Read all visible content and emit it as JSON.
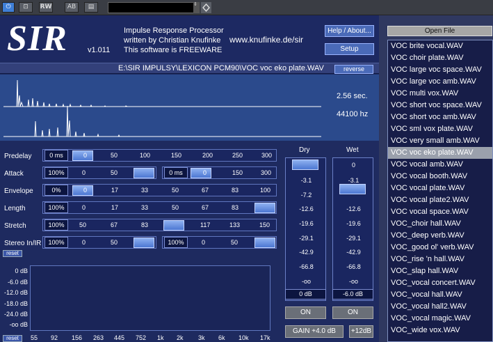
{
  "host": {
    "power": "⏻",
    "compare": "⊡",
    "rw": "RW",
    "ab": "AB",
    "menu": "▤",
    "arrows": "⇕",
    "preset": ""
  },
  "header": {
    "logo": "SIR",
    "version": "v1.011",
    "line1": "Impulse Response Processor",
    "line2": "written by Christian Knufinke",
    "line3": "This software is FREEWARE",
    "url": "www.knufinke.de/sir",
    "help": "Help / About...",
    "setup": "Setup"
  },
  "file": {
    "path": "E:\\SIR IMPULSY\\LEXICON PCM90\\VOC voc eko plate.WAV",
    "reverse": "reverse",
    "duration": "2.56 sec.",
    "samplerate": "44100 hz"
  },
  "params": {
    "predelay": {
      "label": "Predelay",
      "value": "0 ms",
      "ticks": [
        "0",
        "50",
        "100",
        "150",
        "200",
        "250",
        "300"
      ]
    },
    "attack": {
      "label": "Attack",
      "value": "100%",
      "ticks": [
        "0",
        "50"
      ],
      "value2": "0 ms",
      "ticks2": [
        "0",
        "150",
        "300"
      ]
    },
    "envelope": {
      "label": "Envelope",
      "value": "0%",
      "ticks": [
        "0",
        "17",
        "33",
        "50",
        "67",
        "83",
        "100"
      ]
    },
    "length": {
      "label": "Length",
      "value": "100%",
      "ticks": [
        "0",
        "17",
        "33",
        "50",
        "67",
        "83",
        "100"
      ]
    },
    "stretch": {
      "label": "Stretch",
      "value": "100%",
      "ticks": [
        "50",
        "67",
        "83",
        "100",
        "117",
        "133",
        "150"
      ]
    },
    "stereo": {
      "label": "Stereo In/IR",
      "value": "100%",
      "ticks": [
        "0",
        "50"
      ],
      "value2": "100%",
      "ticks2": [
        "0",
        "50"
      ]
    }
  },
  "mix": {
    "dry": {
      "label": "Dry",
      "ticks": [
        "-3.1",
        "-7.2",
        "-12.6",
        "-19.6",
        "-29.1",
        "-42.9",
        "-66.8",
        "-oo"
      ],
      "value": "0 dB",
      "on": "ON",
      "level": 1.0
    },
    "wet": {
      "label": "Wet",
      "ticks": [
        "0",
        "-3.1",
        "-7.2",
        "-12.6",
        "-19.6",
        "-29.1",
        "-42.9",
        "-66.8",
        "-oo"
      ],
      "value": "-6.0 dB",
      "on": "ON",
      "level": 0.72
    },
    "gain": "GAIN +4.0 dB",
    "plus12": "+12dB"
  },
  "eq": {
    "reset_top": "reset",
    "reset_bottom": "reset",
    "db": [
      "0 dB",
      "-6.0 dB",
      "-12.0 dB",
      "-18.0 dB",
      "-24.0 dB",
      "-oo dB"
    ],
    "freqs": [
      "55",
      "92",
      "156",
      "263",
      "445",
      "752",
      "1k",
      "2k",
      "3k",
      "6k",
      "10k",
      "17k"
    ]
  },
  "filelist": {
    "open": "Open File",
    "selected": "VOC voc eko plate.WAV",
    "items": [
      "VOC brite vocal.WAV",
      "VOC choir plate.WAV",
      "VOC large voc space.WAV",
      "VOC large voc amb.WAV",
      "VOC multi vox.WAV",
      "VOC short voc space.WAV",
      "VOC short voc amb.WAV",
      "VOC sml vox plate.WAV",
      "VOC very small amb.WAV",
      "VOC voc eko plate.WAV",
      "VOC vocal amb.WAV",
      "VOC vocal booth.WAV",
      "VOC vocal plate.WAV",
      "VOC vocal plate2.WAV",
      "VOC vocal space.WAV",
      "VOC_choir hall.WAV",
      "VOC_deep verb.WAV",
      "VOC_good ol' verb.WAV",
      "VOC_rise 'n hall.WAV",
      "VOC_slap hall.WAV",
      "VOC_vocal concert.WAV",
      "VOC_vocal hall.WAV",
      "VOC_vocal hall2.WAV",
      "VOC_vocal magic.WAV",
      "VOC_wide vox.WAV"
    ]
  },
  "colors": {
    "panel": "#1f2b60",
    "accent": "#4a6ab8",
    "wave": "#2b4a8c"
  }
}
